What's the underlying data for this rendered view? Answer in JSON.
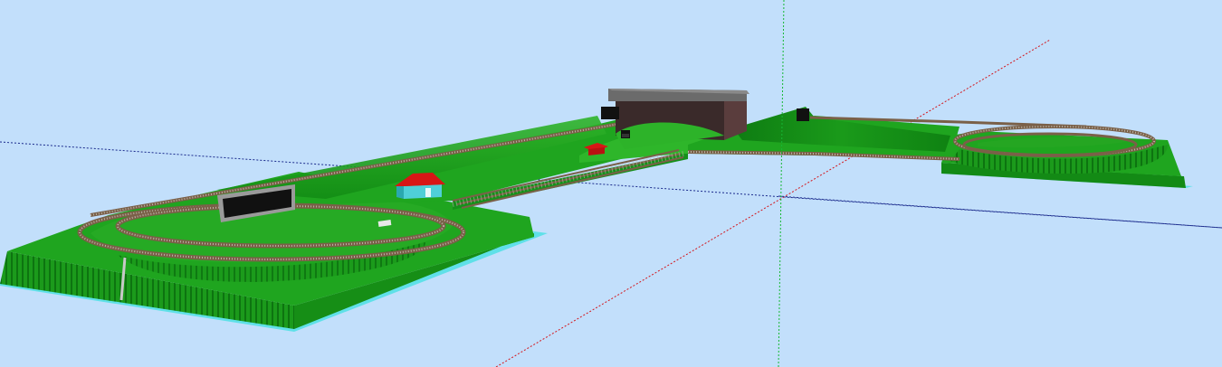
{
  "viewport": {
    "background": "#c2dffb",
    "colors": {
      "terrain": "#1fa51f",
      "terrain_light": "#38bd2c",
      "terrain_dark": "#0f7a12",
      "cliff": "#128c14",
      "base_edge": "#5fe0e8",
      "track_rail": "#7a6048",
      "track_ties": "#b9b2a6",
      "x_axis": "#1a2a8c",
      "y_axis": "#d4161c",
      "z_axis": "#16b834",
      "roof_red": "#d81616",
      "wall_cyan": "#4fcfd8",
      "building_dark": "#3a2a2a",
      "building_roof": "#6b6b6b",
      "tunnel": "#111111"
    }
  }
}
